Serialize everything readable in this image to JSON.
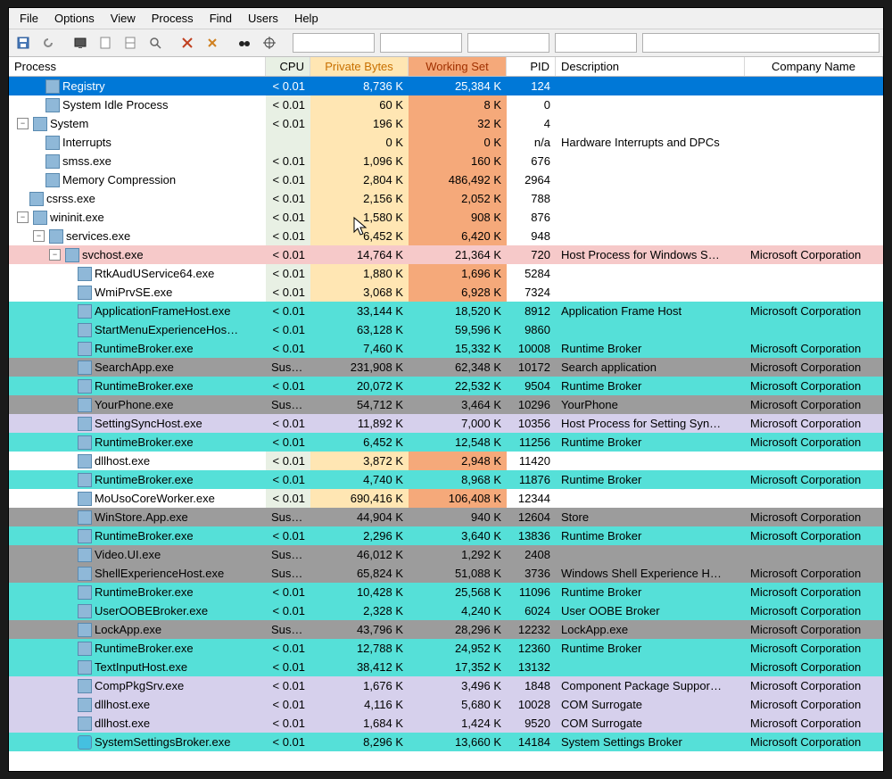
{
  "menu": [
    "File",
    "Options",
    "View",
    "Process",
    "Find",
    "Users",
    "Help"
  ],
  "columns": {
    "process": "Process",
    "cpu": "CPU",
    "priv": "Private Bytes",
    "work": "Working Set",
    "pid": "PID",
    "desc": "Description",
    "comp": "Company Name"
  },
  "rows": [
    {
      "depth": 1,
      "exp": null,
      "name": "Registry",
      "cpu": "< 0.01",
      "priv": "8,736 K",
      "work": "25,384 K",
      "pid": "124",
      "desc": "",
      "comp": "",
      "sel": true
    },
    {
      "depth": 1,
      "exp": null,
      "name": "System Idle Process",
      "cpu": "< 0.01",
      "priv": "60 K",
      "work": "8 K",
      "pid": "0",
      "desc": "",
      "comp": ""
    },
    {
      "depth": 0,
      "exp": "-",
      "name": "System",
      "cpu": "< 0.01",
      "priv": "196 K",
      "work": "32 K",
      "pid": "4",
      "desc": "",
      "comp": ""
    },
    {
      "depth": 1,
      "exp": null,
      "name": "Interrupts",
      "cpu": "",
      "priv": "0 K",
      "work": "0 K",
      "pid": "n/a",
      "desc": "Hardware Interrupts and DPCs",
      "comp": ""
    },
    {
      "depth": 1,
      "exp": null,
      "name": "smss.exe",
      "cpu": "< 0.01",
      "priv": "1,096 K",
      "work": "160 K",
      "pid": "676",
      "desc": "",
      "comp": ""
    },
    {
      "depth": 1,
      "exp": null,
      "name": "Memory Compression",
      "cpu": "< 0.01",
      "priv": "2,804 K",
      "work": "486,492 K",
      "pid": "2964",
      "desc": "",
      "comp": ""
    },
    {
      "depth": 0,
      "exp": null,
      "name": "csrss.exe",
      "cpu": "< 0.01",
      "priv": "2,156 K",
      "work": "2,052 K",
      "pid": "788",
      "desc": "",
      "comp": ""
    },
    {
      "depth": 0,
      "exp": "-",
      "name": "wininit.exe",
      "cpu": "< 0.01",
      "priv": "1,580 K",
      "work": "908 K",
      "pid": "876",
      "desc": "",
      "comp": ""
    },
    {
      "depth": 1,
      "exp": "-",
      "name": "services.exe",
      "cpu": "< 0.01",
      "priv": "6,452 K",
      "work": "6,420 K",
      "pid": "948",
      "desc": "",
      "comp": ""
    },
    {
      "depth": 2,
      "exp": "-",
      "name": "svchost.exe",
      "cpu": "< 0.01",
      "priv": "14,764 K",
      "work": "21,364 K",
      "pid": "720",
      "desc": "Host Process for Windows S…",
      "comp": "Microsoft Corporation",
      "bg": "pink"
    },
    {
      "depth": 3,
      "exp": null,
      "name": "RtkAudUService64.exe",
      "cpu": "< 0.01",
      "priv": "1,880 K",
      "work": "1,696 K",
      "pid": "5284",
      "desc": "",
      "comp": ""
    },
    {
      "depth": 3,
      "exp": null,
      "name": "WmiPrvSE.exe",
      "cpu": "< 0.01",
      "priv": "3,068 K",
      "work": "6,928 K",
      "pid": "7324",
      "desc": "",
      "comp": ""
    },
    {
      "depth": 3,
      "exp": null,
      "name": "ApplicationFrameHost.exe",
      "cpu": "< 0.01",
      "priv": "33,144 K",
      "work": "18,520 K",
      "pid": "8912",
      "desc": "Application Frame Host",
      "comp": "Microsoft Corporation",
      "bg": "cyan"
    },
    {
      "depth": 3,
      "exp": null,
      "name": "StartMenuExperienceHos…",
      "cpu": "< 0.01",
      "priv": "63,128 K",
      "work": "59,596 K",
      "pid": "9860",
      "desc": "",
      "comp": "",
      "bg": "cyan"
    },
    {
      "depth": 3,
      "exp": null,
      "name": "RuntimeBroker.exe",
      "cpu": "< 0.01",
      "priv": "7,460 K",
      "work": "15,332 K",
      "pid": "10008",
      "desc": "Runtime Broker",
      "comp": "Microsoft Corporation",
      "bg": "cyan"
    },
    {
      "depth": 3,
      "exp": null,
      "name": "SearchApp.exe",
      "cpu": "Susp…",
      "priv": "231,908 K",
      "work": "62,348 K",
      "pid": "10172",
      "desc": "Search application",
      "comp": "Microsoft Corporation",
      "bg": "grey"
    },
    {
      "depth": 3,
      "exp": null,
      "name": "RuntimeBroker.exe",
      "cpu": "< 0.01",
      "priv": "20,072 K",
      "work": "22,532 K",
      "pid": "9504",
      "desc": "Runtime Broker",
      "comp": "Microsoft Corporation",
      "bg": "cyan"
    },
    {
      "depth": 3,
      "exp": null,
      "name": "YourPhone.exe",
      "cpu": "Susp…",
      "priv": "54,712 K",
      "work": "3,464 K",
      "pid": "10296",
      "desc": "YourPhone",
      "comp": "Microsoft Corporation",
      "bg": "grey"
    },
    {
      "depth": 3,
      "exp": null,
      "name": "SettingSyncHost.exe",
      "cpu": "< 0.01",
      "priv": "11,892 K",
      "work": "7,000 K",
      "pid": "10356",
      "desc": "Host Process for Setting Syn…",
      "comp": "Microsoft Corporation",
      "bg": "lilac"
    },
    {
      "depth": 3,
      "exp": null,
      "name": "RuntimeBroker.exe",
      "cpu": "< 0.01",
      "priv": "6,452 K",
      "work": "12,548 K",
      "pid": "11256",
      "desc": "Runtime Broker",
      "comp": "Microsoft Corporation",
      "bg": "cyan"
    },
    {
      "depth": 3,
      "exp": null,
      "name": "dllhost.exe",
      "cpu": "< 0.01",
      "priv": "3,872 K",
      "work": "2,948 K",
      "pid": "11420",
      "desc": "",
      "comp": ""
    },
    {
      "depth": 3,
      "exp": null,
      "name": "RuntimeBroker.exe",
      "cpu": "< 0.01",
      "priv": "4,740 K",
      "work": "8,968 K",
      "pid": "11876",
      "desc": "Runtime Broker",
      "comp": "Microsoft Corporation",
      "bg": "cyan"
    },
    {
      "depth": 3,
      "exp": null,
      "name": "MoUsoCoreWorker.exe",
      "cpu": "< 0.01",
      "priv": "690,416 K",
      "work": "106,408 K",
      "pid": "12344",
      "desc": "",
      "comp": ""
    },
    {
      "depth": 3,
      "exp": null,
      "name": "WinStore.App.exe",
      "cpu": "Susp…",
      "priv": "44,904 K",
      "work": "940 K",
      "pid": "12604",
      "desc": "Store",
      "comp": "Microsoft Corporation",
      "bg": "grey"
    },
    {
      "depth": 3,
      "exp": null,
      "name": "RuntimeBroker.exe",
      "cpu": "< 0.01",
      "priv": "2,296 K",
      "work": "3,640 K",
      "pid": "13836",
      "desc": "Runtime Broker",
      "comp": "Microsoft Corporation",
      "bg": "cyan"
    },
    {
      "depth": 3,
      "exp": null,
      "name": "Video.UI.exe",
      "cpu": "Susp…",
      "priv": "46,012 K",
      "work": "1,292 K",
      "pid": "2408",
      "desc": "",
      "comp": "",
      "bg": "grey"
    },
    {
      "depth": 3,
      "exp": null,
      "name": "ShellExperienceHost.exe",
      "cpu": "Susp…",
      "priv": "65,824 K",
      "work": "51,088 K",
      "pid": "3736",
      "desc": "Windows Shell Experience H…",
      "comp": "Microsoft Corporation",
      "bg": "grey"
    },
    {
      "depth": 3,
      "exp": null,
      "name": "RuntimeBroker.exe",
      "cpu": "< 0.01",
      "priv": "10,428 K",
      "work": "25,568 K",
      "pid": "11096",
      "desc": "Runtime Broker",
      "comp": "Microsoft Corporation",
      "bg": "cyan"
    },
    {
      "depth": 3,
      "exp": null,
      "name": "UserOOBEBroker.exe",
      "cpu": "< 0.01",
      "priv": "2,328 K",
      "work": "4,240 K",
      "pid": "6024",
      "desc": "User OOBE Broker",
      "comp": "Microsoft Corporation",
      "bg": "cyan"
    },
    {
      "depth": 3,
      "exp": null,
      "name": "LockApp.exe",
      "cpu": "Susp…",
      "priv": "43,796 K",
      "work": "28,296 K",
      "pid": "12232",
      "desc": "LockApp.exe",
      "comp": "Microsoft Corporation",
      "bg": "grey"
    },
    {
      "depth": 3,
      "exp": null,
      "name": "RuntimeBroker.exe",
      "cpu": "< 0.01",
      "priv": "12,788 K",
      "work": "24,952 K",
      "pid": "12360",
      "desc": "Runtime Broker",
      "comp": "Microsoft Corporation",
      "bg": "cyan"
    },
    {
      "depth": 3,
      "exp": null,
      "name": "TextInputHost.exe",
      "cpu": "< 0.01",
      "priv": "38,412 K",
      "work": "17,352 K",
      "pid": "13132",
      "desc": "",
      "comp": "Microsoft Corporation",
      "bg": "cyan"
    },
    {
      "depth": 3,
      "exp": null,
      "name": "CompPkgSrv.exe",
      "cpu": "< 0.01",
      "priv": "1,676 K",
      "work": "3,496 K",
      "pid": "1848",
      "desc": "Component Package Suppor…",
      "comp": "Microsoft Corporation",
      "bg": "lilac"
    },
    {
      "depth": 3,
      "exp": null,
      "name": "dllhost.exe",
      "cpu": "< 0.01",
      "priv": "4,116 K",
      "work": "5,680 K",
      "pid": "10028",
      "desc": "COM Surrogate",
      "comp": "Microsoft Corporation",
      "bg": "lilac"
    },
    {
      "depth": 3,
      "exp": null,
      "name": "dllhost.exe",
      "cpu": "< 0.01",
      "priv": "1,684 K",
      "work": "1,424 K",
      "pid": "9520",
      "desc": "COM Surrogate",
      "comp": "Microsoft Corporation",
      "bg": "lilac"
    },
    {
      "depth": 3,
      "exp": null,
      "name": "SystemSettingsBroker.exe",
      "cpu": "< 0.01",
      "priv": "8,296 K",
      "work": "13,660 K",
      "pid": "14184",
      "desc": "System Settings Broker",
      "comp": "Microsoft Corporation",
      "bg": "cyan",
      "icon": "gear"
    }
  ]
}
